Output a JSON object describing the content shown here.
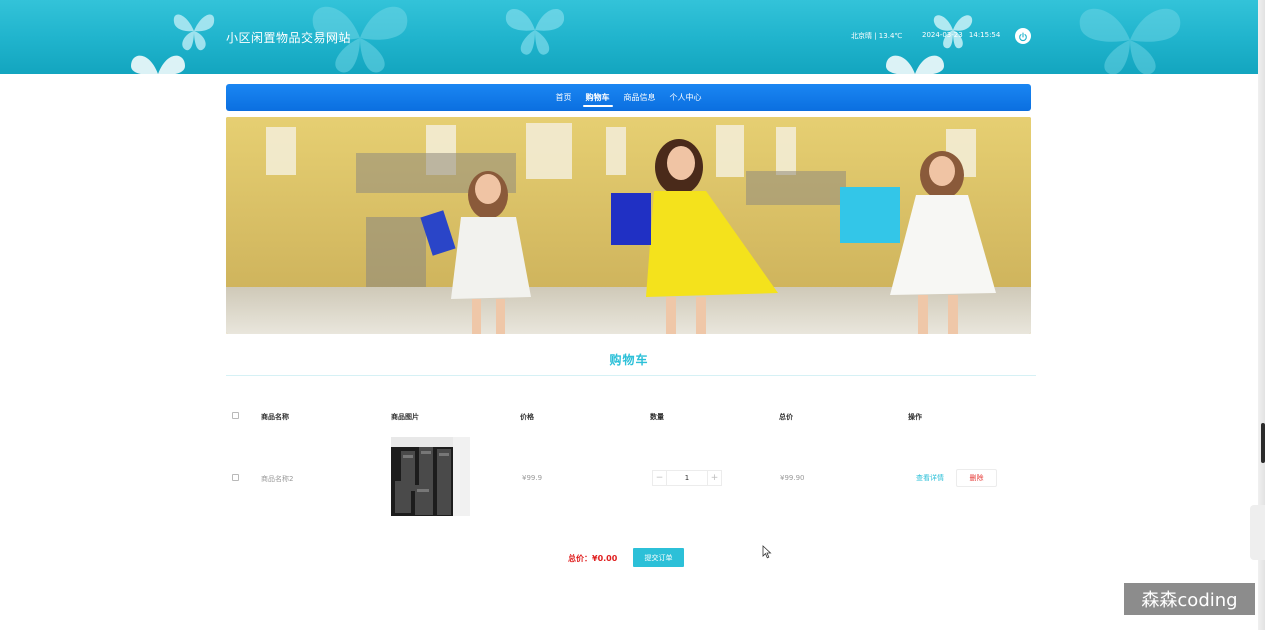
{
  "header": {
    "site_title": "小区闲置物品交易网站",
    "weather": "北京晴 | 13.4℃",
    "datetime": "2024-03-23  14:15:54",
    "power_icon": "power-icon"
  },
  "nav": {
    "items": [
      {
        "label": "首页"
      },
      {
        "label": "购物车"
      },
      {
        "label": "商品信息"
      },
      {
        "label": "个人中心"
      }
    ],
    "active": "购物车"
  },
  "section": {
    "title": "购物车"
  },
  "cart": {
    "headers": {
      "name": "商品名称",
      "image": "商品图片",
      "price": "价格",
      "quantity": "数量",
      "total": "总价",
      "actions": "操作"
    },
    "rows": [
      {
        "name": "商品名称2",
        "price": "¥99.9",
        "quantity": "1",
        "total": "¥99.90",
        "detail_label": "查看详情",
        "delete_label": "删除"
      }
    ],
    "minus": "−",
    "plus": "+"
  },
  "footer": {
    "total_label": "总价：",
    "total_value": "¥0.00",
    "submit_label": "提交订单"
  },
  "watermark": "森森coding",
  "colors": {
    "header": "#1fb3cc",
    "nav": "#0b6fe0",
    "accent": "#2cc0d8",
    "danger": "#e02020"
  }
}
